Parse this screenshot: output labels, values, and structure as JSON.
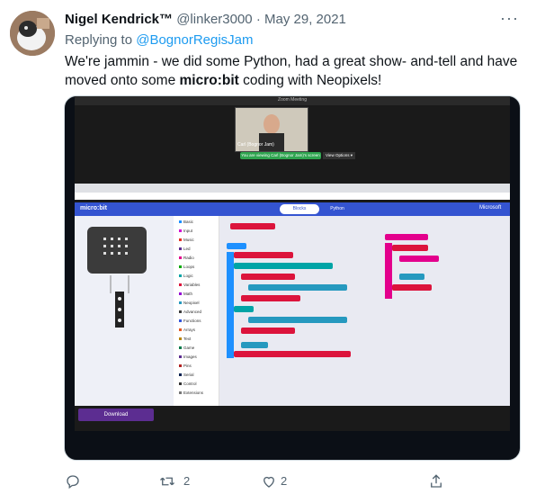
{
  "author": {
    "name": "Nigel Kendrick™",
    "handle": "@linker3000",
    "separator": "·",
    "date": "May 29, 2021"
  },
  "reply": {
    "prefix": "Replying to",
    "to": "@BognorRegisJam"
  },
  "text": {
    "part1": "We're jammin - we did some Python, had a great show- and-tell and have moved onto some ",
    "bold": "micro:bit",
    "part2": " coding with Neopixels!"
  },
  "media": {
    "zoom_title": "Zoom Meeting",
    "cam_name": "Carl (Bognor Jam)",
    "viewing": "You are viewing Carl (Bognor Jam)'s screen",
    "view_options": "View Options ▾",
    "app_name": "micro:bit",
    "tabs": [
      "Blocks",
      "Python"
    ],
    "brand": "Microsoft",
    "download": "Download",
    "categories": [
      {
        "label": "Basic",
        "color": "#1e90ff"
      },
      {
        "label": "Input",
        "color": "#d400d4"
      },
      {
        "label": "Music",
        "color": "#e63022"
      },
      {
        "label": "Led",
        "color": "#5c2d91"
      },
      {
        "label": "Radio",
        "color": "#e3008c"
      },
      {
        "label": "Loops",
        "color": "#00aa00"
      },
      {
        "label": "Logic",
        "color": "#00a4a6"
      },
      {
        "label": "Variables",
        "color": "#dc143c"
      },
      {
        "label": "Math",
        "color": "#9400d3"
      },
      {
        "label": "Neopixel",
        "color": "#2699bf"
      },
      {
        "label": "Advanced",
        "color": "#3c3c3c"
      },
      {
        "label": "Functions",
        "color": "#3455db"
      },
      {
        "label": "Arrays",
        "color": "#e65722"
      },
      {
        "label": "Text",
        "color": "#b8860b"
      },
      {
        "label": "Game",
        "color": "#007a4b"
      },
      {
        "label": "Images",
        "color": "#5c2d91"
      },
      {
        "label": "Pins",
        "color": "#b22222"
      },
      {
        "label": "Serial",
        "color": "#002050"
      },
      {
        "label": "Control",
        "color": "#333333"
      },
      {
        "label": "Extensions",
        "color": "#777777"
      }
    ]
  },
  "actions": {
    "retweets": "2",
    "likes": "2"
  }
}
